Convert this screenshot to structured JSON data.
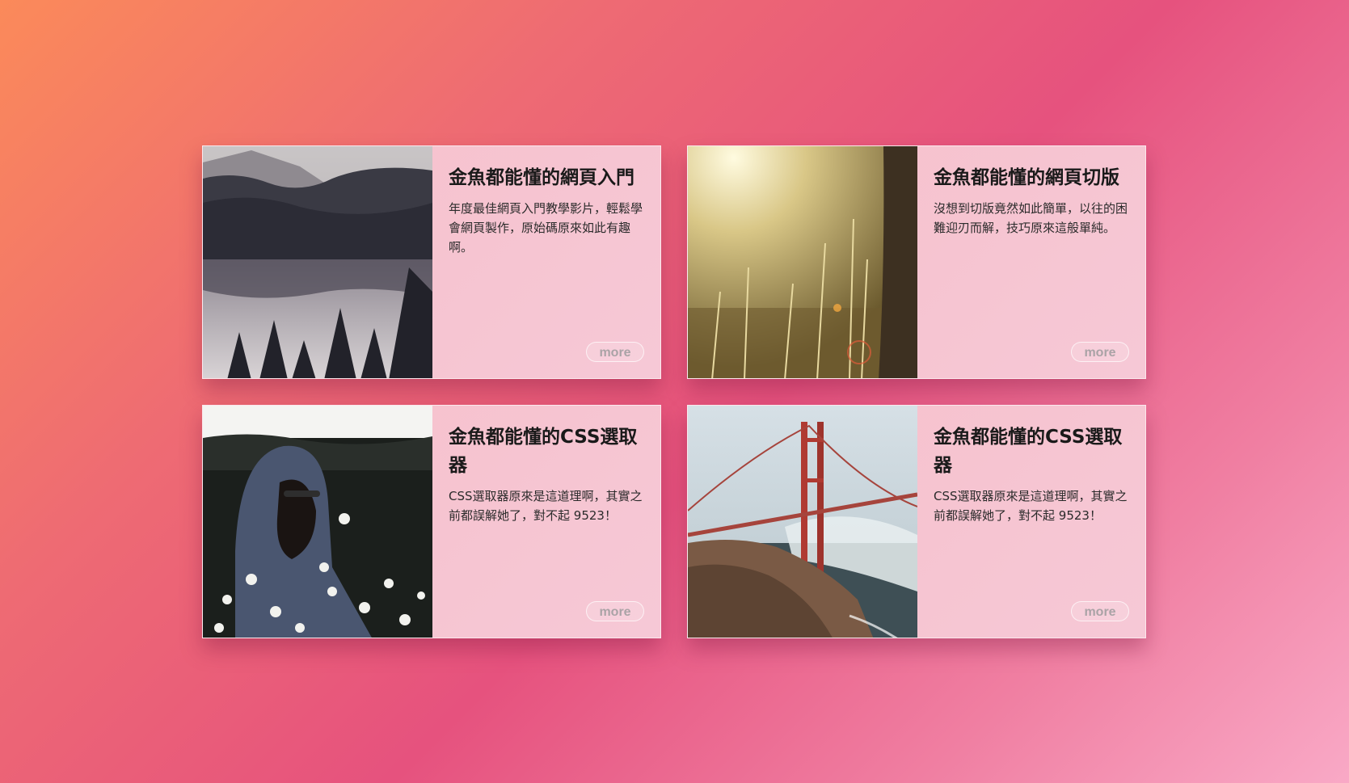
{
  "cards": [
    {
      "title": "金魚都能懂的網頁入門",
      "description": "年度最佳網頁入門教學影片，輕鬆學會網頁製作，原始碼原來如此有趣啊。",
      "image": "forest-lake-photo",
      "more_label": "more"
    },
    {
      "title": "金魚都能懂的網頁切版",
      "description": "沒想到切版竟然如此簡單，以往的困難迎刃而解，技巧原來這般單純。",
      "image": "sunlit-grass-photo",
      "more_label": "more"
    },
    {
      "title": "金魚都能懂的CSS選取器",
      "description": "CSS選取器原來是這道理啊，其實之前都誤解她了，對不起 9523！",
      "image": "hooded-person-daisies-photo",
      "more_label": "more"
    },
    {
      "title": "金魚都能懂的CSS選取器",
      "description": "CSS選取器原來是這道理啊，其實之前都誤解她了，對不起 9523！",
      "image": "golden-gate-bridge-photo",
      "more_label": "more"
    }
  ],
  "colors": {
    "background_gradient": [
      "#fb8a5a",
      "#e6527e",
      "#f9a9c6"
    ],
    "card_background": "#f7c0cb",
    "more_text": "#aaa3a6"
  }
}
